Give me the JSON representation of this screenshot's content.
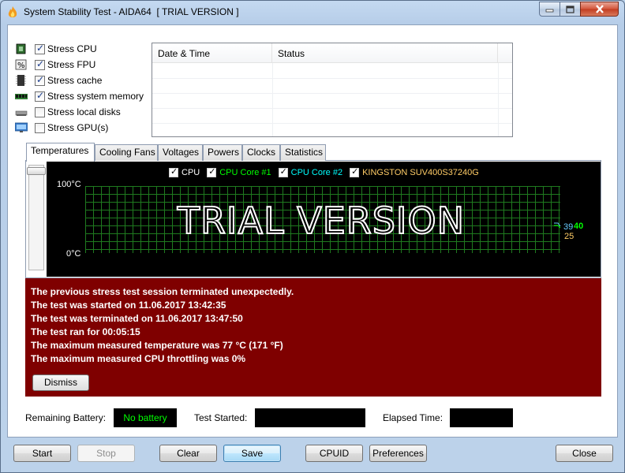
{
  "window": {
    "title": "System Stability Test - AIDA64  [ TRIAL VERSION ]"
  },
  "stress_options": [
    {
      "label": "Stress CPU",
      "checked": true,
      "icon": "cpu-chip-icon"
    },
    {
      "label": "Stress FPU",
      "checked": true,
      "icon": "fpu-percent-icon"
    },
    {
      "label": "Stress cache",
      "checked": true,
      "icon": "cache-chip-icon"
    },
    {
      "label": "Stress system memory",
      "checked": true,
      "icon": "memory-module-icon"
    },
    {
      "label": "Stress local disks",
      "checked": false,
      "icon": "disk-drive-icon"
    },
    {
      "label": "Stress GPU(s)",
      "checked": false,
      "icon": "monitor-gpu-icon"
    }
  ],
  "log": {
    "columns": [
      "Date & Time",
      "Status"
    ]
  },
  "tabs": [
    "Temperatures",
    "Cooling Fans",
    "Voltages",
    "Powers",
    "Clocks",
    "Statistics"
  ],
  "active_tab": "Temperatures",
  "graph": {
    "legend": [
      {
        "label": "CPU",
        "color": "#ffffff"
      },
      {
        "label": "CPU Core #1",
        "color": "#00ff00"
      },
      {
        "label": "CPU Core #2",
        "color": "#00ffff"
      },
      {
        "label": "KINGSTON SUV400S37240G",
        "color": "#ffcc66"
      }
    ],
    "y_max_label": "100°C",
    "y_min_label": "0°C",
    "watermark": "TRIAL VERSION",
    "readings": [
      {
        "value": "39",
        "color": "#66ccff"
      },
      {
        "value": "40",
        "color": "#00ff00"
      },
      {
        "value": "25",
        "color": "#ffcc66"
      }
    ],
    "grid_color": "#1f7a1f"
  },
  "alert": {
    "background": "#7f0000",
    "lines": [
      "The previous stress test session terminated unexpectedly.",
      "The test was started on 11.06.2017 13:42:35",
      "The test was terminated on 11.06.2017 13:47:50",
      "The test ran for 00:05:15",
      "The maximum measured temperature was 77 °C  (171 °F)",
      "The maximum measured CPU throttling was 0%"
    ],
    "dismiss_label": "Dismiss"
  },
  "status": {
    "battery_label": "Remaining Battery:",
    "battery_value": "No battery",
    "started_label": "Test Started:",
    "started_value": "",
    "elapsed_label": "Elapsed Time:",
    "elapsed_value": ""
  },
  "buttons": {
    "start": "Start",
    "stop": "Stop",
    "clear": "Clear",
    "save": "Save",
    "cpuid": "CPUID",
    "preferences": "Preferences",
    "close": "Close"
  }
}
